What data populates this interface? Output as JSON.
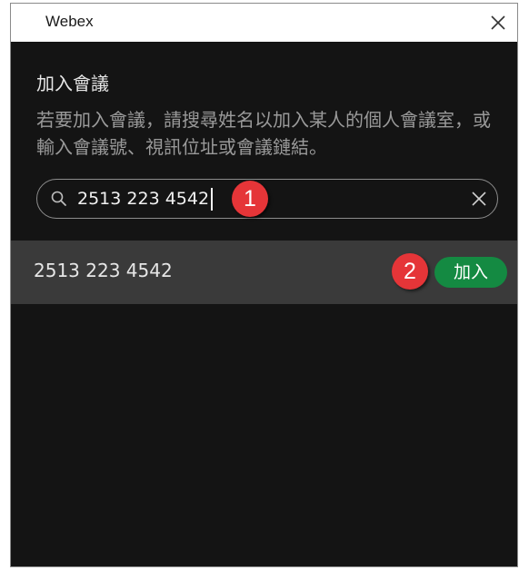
{
  "window": {
    "title": "Webex"
  },
  "panel": {
    "title": "加入會議",
    "description": "若要加入會議，請搜尋姓名以加入某人的個人會議室，或輸入會議號、視訊位址或會議鏈結。"
  },
  "search": {
    "value": "2513 223 4542",
    "icon": "search-icon",
    "clear_icon": "clear-icon"
  },
  "results": [
    {
      "number": "2513 223 4542",
      "join_label": "加入"
    }
  ],
  "annotations": {
    "step1": "1",
    "step2": "2"
  },
  "colors": {
    "background": "#141414",
    "result_row": "#3a3a3a",
    "join_button": "#148a42",
    "annotation_badge": "#e53538",
    "secondary_text": "#9a9a9a"
  }
}
